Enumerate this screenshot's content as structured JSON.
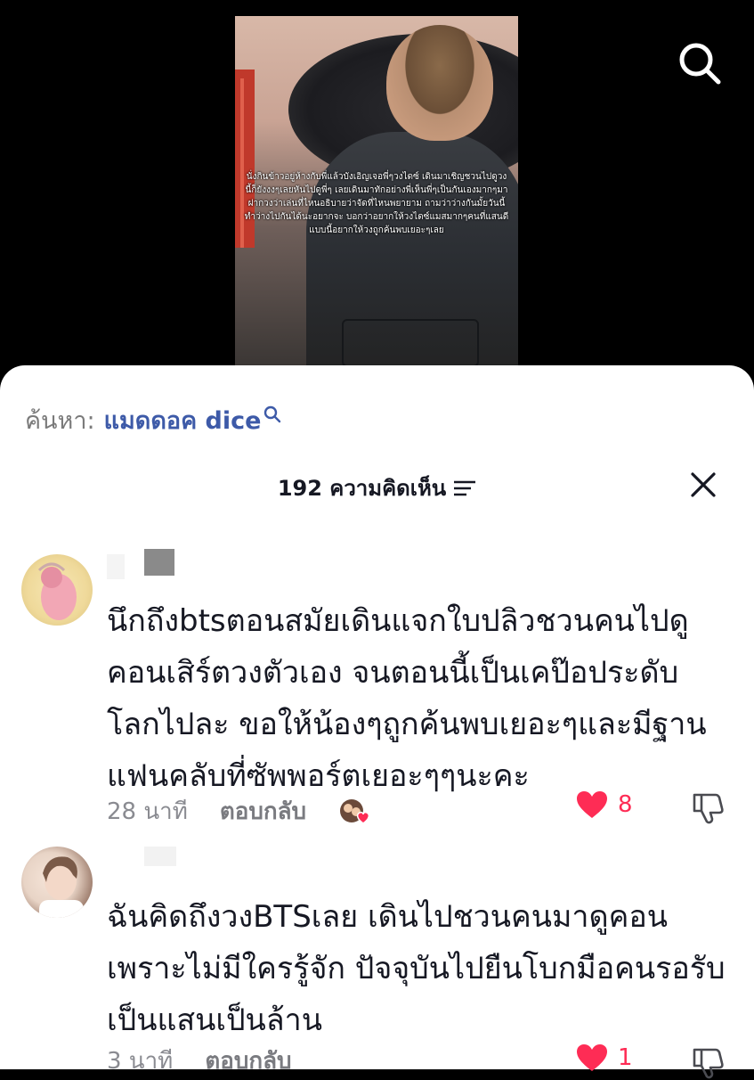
{
  "video": {
    "caption": "นั่งกินข้าวอยู่ห้างกับพี่แล้วบังเอิญเจอพี่ๆวงไดซ์ เดินมาเชิญชวนไปดูวงนี้ก็ยังงงๆเลยหันไปดูพี่ๆ เลยเดินมาทักอย่างพี่เห็นพี่ๆเป็นกันเองมากๆมา ฝากวงว่าเล่นที่ไหนอธิบายว่าจัดที่ไหนพยายาม ถามว่าว่างกันมั้ยวันนี้ทำว่างไปกันได้นะอยากจะ บอกว่าอยากให้วงไดซ์แมสมากๆคนที่แสนดี แบบนี้อยากให้วงถูกค้นพบเยอะๆเลย"
  },
  "icons": {
    "search": "search-icon",
    "close": "close-icon",
    "sort": "sort-icon",
    "like": "heart-icon",
    "dislike": "thumbs-down-icon"
  },
  "colors": {
    "accent_red": "#fe2c55",
    "link_blue": "#3d5aa8",
    "text_dark": "#161823",
    "text_grey": "#8a8b91"
  },
  "search_suggestion": {
    "label": "ค้นหา:",
    "query": "แมดดอค dice"
  },
  "comments_header": {
    "count_label": "192 ความคิดเห็น"
  },
  "comments": [
    {
      "text": "นึกถึงbtsตอนสมัยเดินแจกใบปลิวชวนคนไปดูคอนเสิร์ตวงตัวเอง จนตอนนี้เป็นเคป๊อประดับโลกไปละ ขอให้น้องๆถูกค้นพบเยอะๆและมีฐานแฟนคลับที่ซัพพอร์ตเยอะๆๆนะคะ",
      "time": "28 นาที",
      "reply_label": "ตอบกลับ",
      "likes": "8",
      "liked": true
    },
    {
      "text": "ฉันคิดถึงวงBTSเลย เดินไปชวนคนมาดูคอนเพราะไม่มีใครรู้จัก ปัจจุบันไปยืนโบกมือคนรอรับเป็นแสนเป็นล้าน",
      "time": "3 นาที",
      "reply_label": "ตอบกลับ",
      "likes": "1",
      "liked": true
    }
  ]
}
